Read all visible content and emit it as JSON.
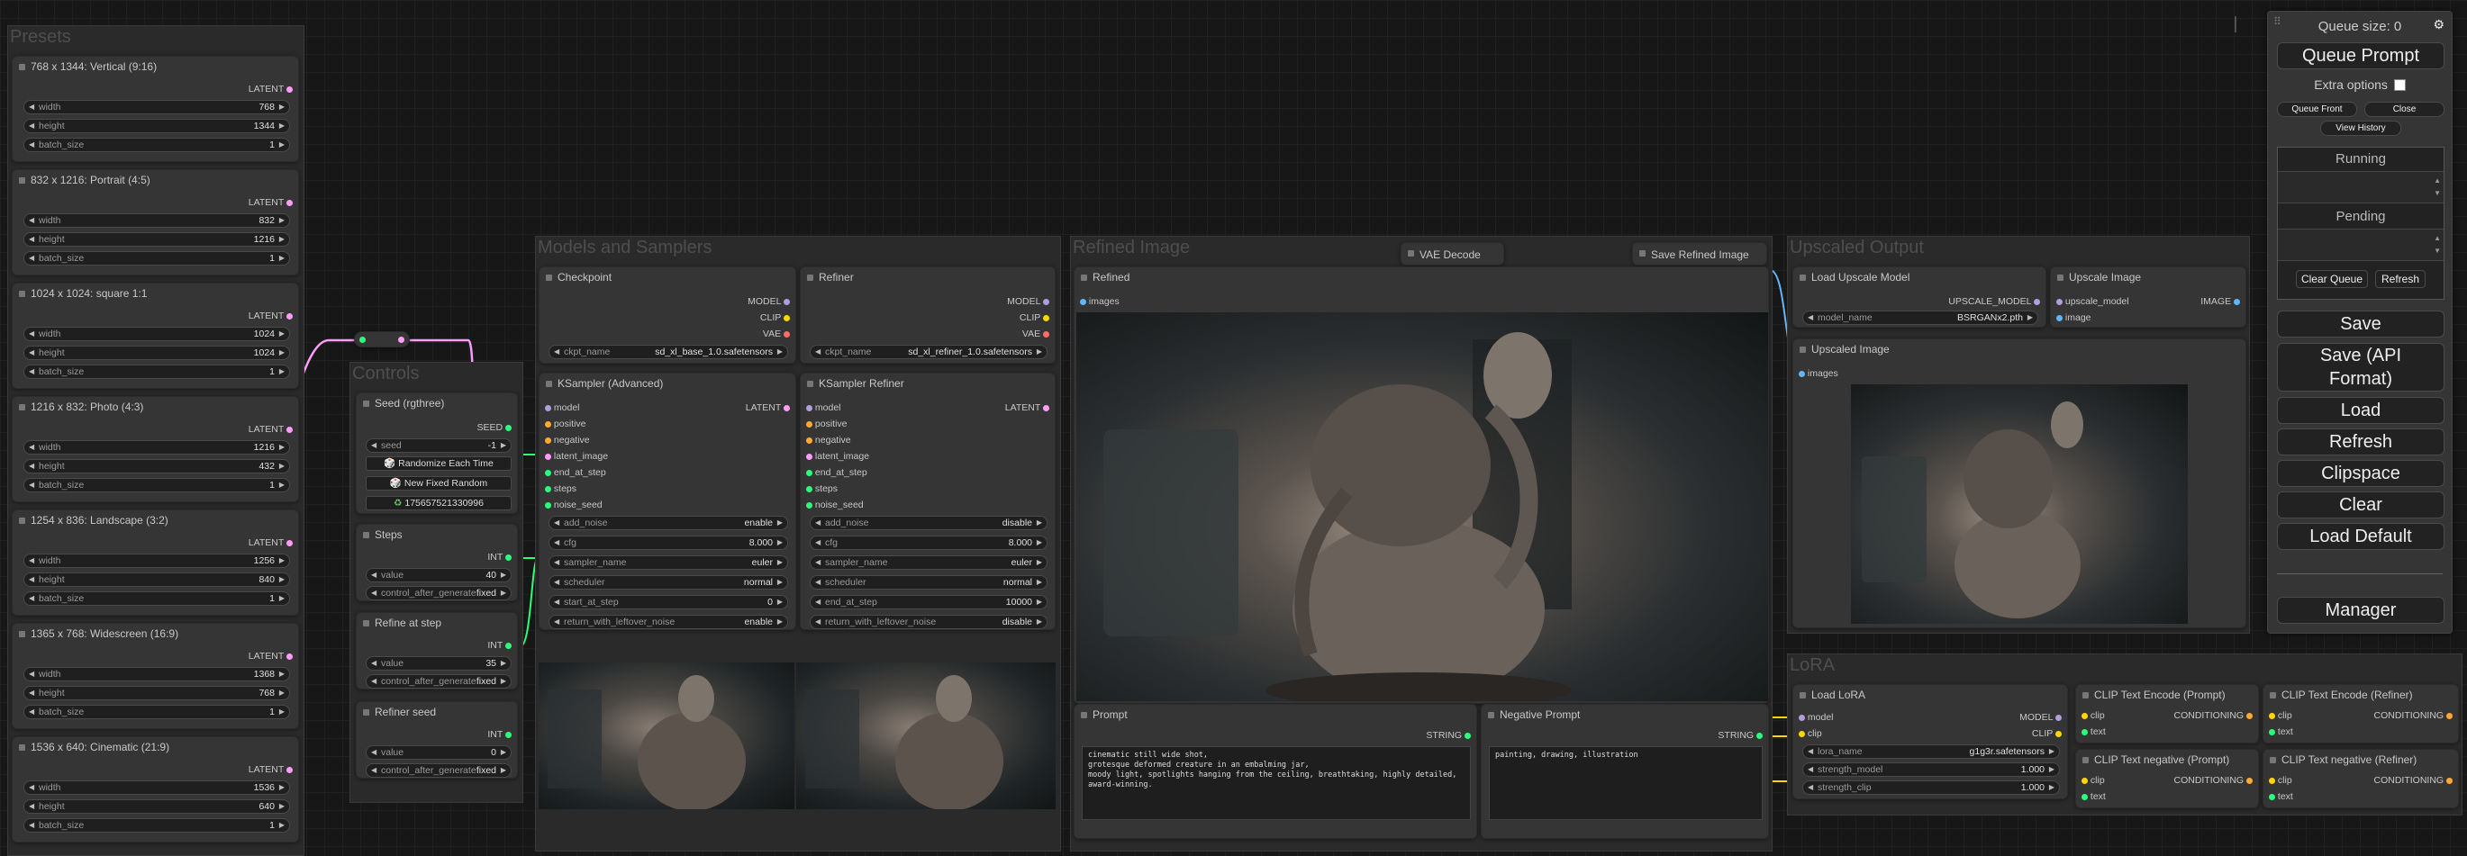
{
  "groups": {
    "presets": "Presets",
    "controls": "Controls",
    "models": "Models and Samplers",
    "refined": "Refined Image",
    "upscaled": "Upscaled Output",
    "lora": "LoRA"
  },
  "presets": [
    {
      "title": "768 x 1344: Vertical (9:16)",
      "width": "768",
      "height": "1344",
      "batch": "1"
    },
    {
      "title": "832 x 1216: Portrait (4:5)",
      "width": "832",
      "height": "1216",
      "batch": "1"
    },
    {
      "title": "1024 x 1024: square 1:1",
      "width": "1024",
      "height": "1024",
      "batch": "1"
    },
    {
      "title": "1216 x 832: Photo (4:3)",
      "width": "1216",
      "height": "432",
      "batch": "1"
    },
    {
      "title": "1254 x 836: Landscape (3:2)",
      "width": "1256",
      "height": "840",
      "batch": "1"
    },
    {
      "title": "1365 x 768: Widescreen (16:9)",
      "width": "1368",
      "height": "768",
      "batch": "1"
    },
    {
      "title": "1536 x 640: Cinematic (21:9)",
      "width": "1536",
      "height": "640",
      "batch": "1"
    }
  ],
  "labels": {
    "latent": "LATENT",
    "width": "width",
    "height": "height",
    "batch_size": "batch_size",
    "seed_out": "SEED",
    "int_out": "INT",
    "model": "MODEL",
    "clip": "CLIP",
    "vae": "VAE",
    "model_in": "model",
    "positive": "positive",
    "negative": "negative",
    "latent_image": "latent_image",
    "end_at_step": "end_at_step",
    "steps": "steps",
    "noise_seed": "noise_seed",
    "images": "images",
    "image_out": "IMAGE",
    "image_in": "image",
    "upscale_model": "UPSCALE_MODEL",
    "upscale_model_in": "upscale_model",
    "string_out": "STRING",
    "clip_in": "clip",
    "text": "text",
    "conditioning": "CONDITIONING",
    "value": "value",
    "control_after_generate": "control_after_generate"
  },
  "controls": {
    "seed_title": "Seed (rgthree)",
    "seed_label": "seed",
    "seed_value": "-1",
    "btn_randomize": "Randomize Each Time",
    "btn_new_fixed": "New Fixed Random",
    "btn_last": "175657521330996",
    "steps_title": "Steps",
    "steps_value": "40",
    "steps_control": "fixed",
    "refine_title": "Refine at step",
    "refine_value": "35",
    "refine_control": "fixed",
    "refiner_seed_title": "Refiner seed",
    "refiner_seed_value": "0",
    "refiner_seed_control": "fixed"
  },
  "checkpoint": {
    "title": "Checkpoint",
    "widget_label": "ckpt_name",
    "widget_value": "sd_xl_base_1.0.safetensors"
  },
  "refiner": {
    "title": "Refiner",
    "widget_label": "ckpt_name",
    "widget_value": "sd_xl_refiner_1.0.safetensors"
  },
  "ksampler_adv": {
    "title": "KSampler (Advanced)",
    "widgets": [
      {
        "label": "add_noise",
        "value": "enable"
      },
      {
        "label": "cfg",
        "value": "8.000"
      },
      {
        "label": "sampler_name",
        "value": "euler"
      },
      {
        "label": "scheduler",
        "value": "normal"
      },
      {
        "label": "start_at_step",
        "value": "0"
      },
      {
        "label": "return_with_leftover_noise",
        "value": "enable"
      }
    ]
  },
  "ksampler_ref": {
    "title": "KSampler Refiner",
    "widgets": [
      {
        "label": "add_noise",
        "value": "disable"
      },
      {
        "label": "cfg",
        "value": "8.000"
      },
      {
        "label": "sampler_name",
        "value": "euler"
      },
      {
        "label": "scheduler",
        "value": "normal"
      },
      {
        "label": "end_at_step",
        "value": "10000"
      },
      {
        "label": "return_with_leftover_noise",
        "value": "disable"
      }
    ]
  },
  "refined": {
    "title": "Refined",
    "vae_decode": "VAE Decode",
    "save_refined": "Save Refined Image"
  },
  "prompt": {
    "title": "Prompt",
    "text": "cinematic still wide shot,\ngrotesque deformed creature in an embalming jar,\nmoody light, spotlights hanging from the ceiling, breathtaking, highly detailed,\naward-winning."
  },
  "negative_prompt": {
    "title": "Negative Prompt",
    "text": "painting, drawing, illustration"
  },
  "upscale": {
    "load_title": "Load Upscale Model",
    "model_label": "model_name",
    "model_value": "BSRGANx2.pth",
    "upscale_title": "Upscale Image",
    "upscaled_title": "Upscaled Image"
  },
  "lora": {
    "title": "Load LoRA",
    "lora_label": "lora_name",
    "lora_value": "g1g3r.safetensors",
    "strength_model_label": "strength_model",
    "strength_model_value": "1.000",
    "strength_clip_label": "strength_clip",
    "strength_clip_value": "1.000",
    "clip_pos": "CLIP Text Encode (Prompt)",
    "clip_pos_ref": "CLIP Text Encode (Refiner)",
    "clip_neg": "CLIP Text negative (Prompt)",
    "clip_neg_ref": "CLIP Text negative (Refiner)"
  },
  "menu": {
    "queue_size": "Queue size: 0",
    "queue_prompt": "Queue Prompt",
    "extra_options": "Extra options",
    "queue_front": "Queue Front",
    "close": "Close",
    "view_history": "View History",
    "running": "Running",
    "pending": "Pending",
    "clear_queue": "Clear Queue",
    "refresh_small": "Refresh",
    "save": "Save",
    "save_api": "Save (API Format)",
    "load": "Load",
    "refresh": "Refresh",
    "clipspace": "Clipspace",
    "clear": "Clear",
    "load_default": "Load Default",
    "manager": "Manager"
  },
  "colors": {
    "latent": "#ff9cf9",
    "model": "#b39ddb",
    "clip": "#ffd500",
    "vae": "#ff6e6e",
    "int": "#29ff7a",
    "image": "#64b5f6",
    "conditioning": "#ffa931"
  }
}
